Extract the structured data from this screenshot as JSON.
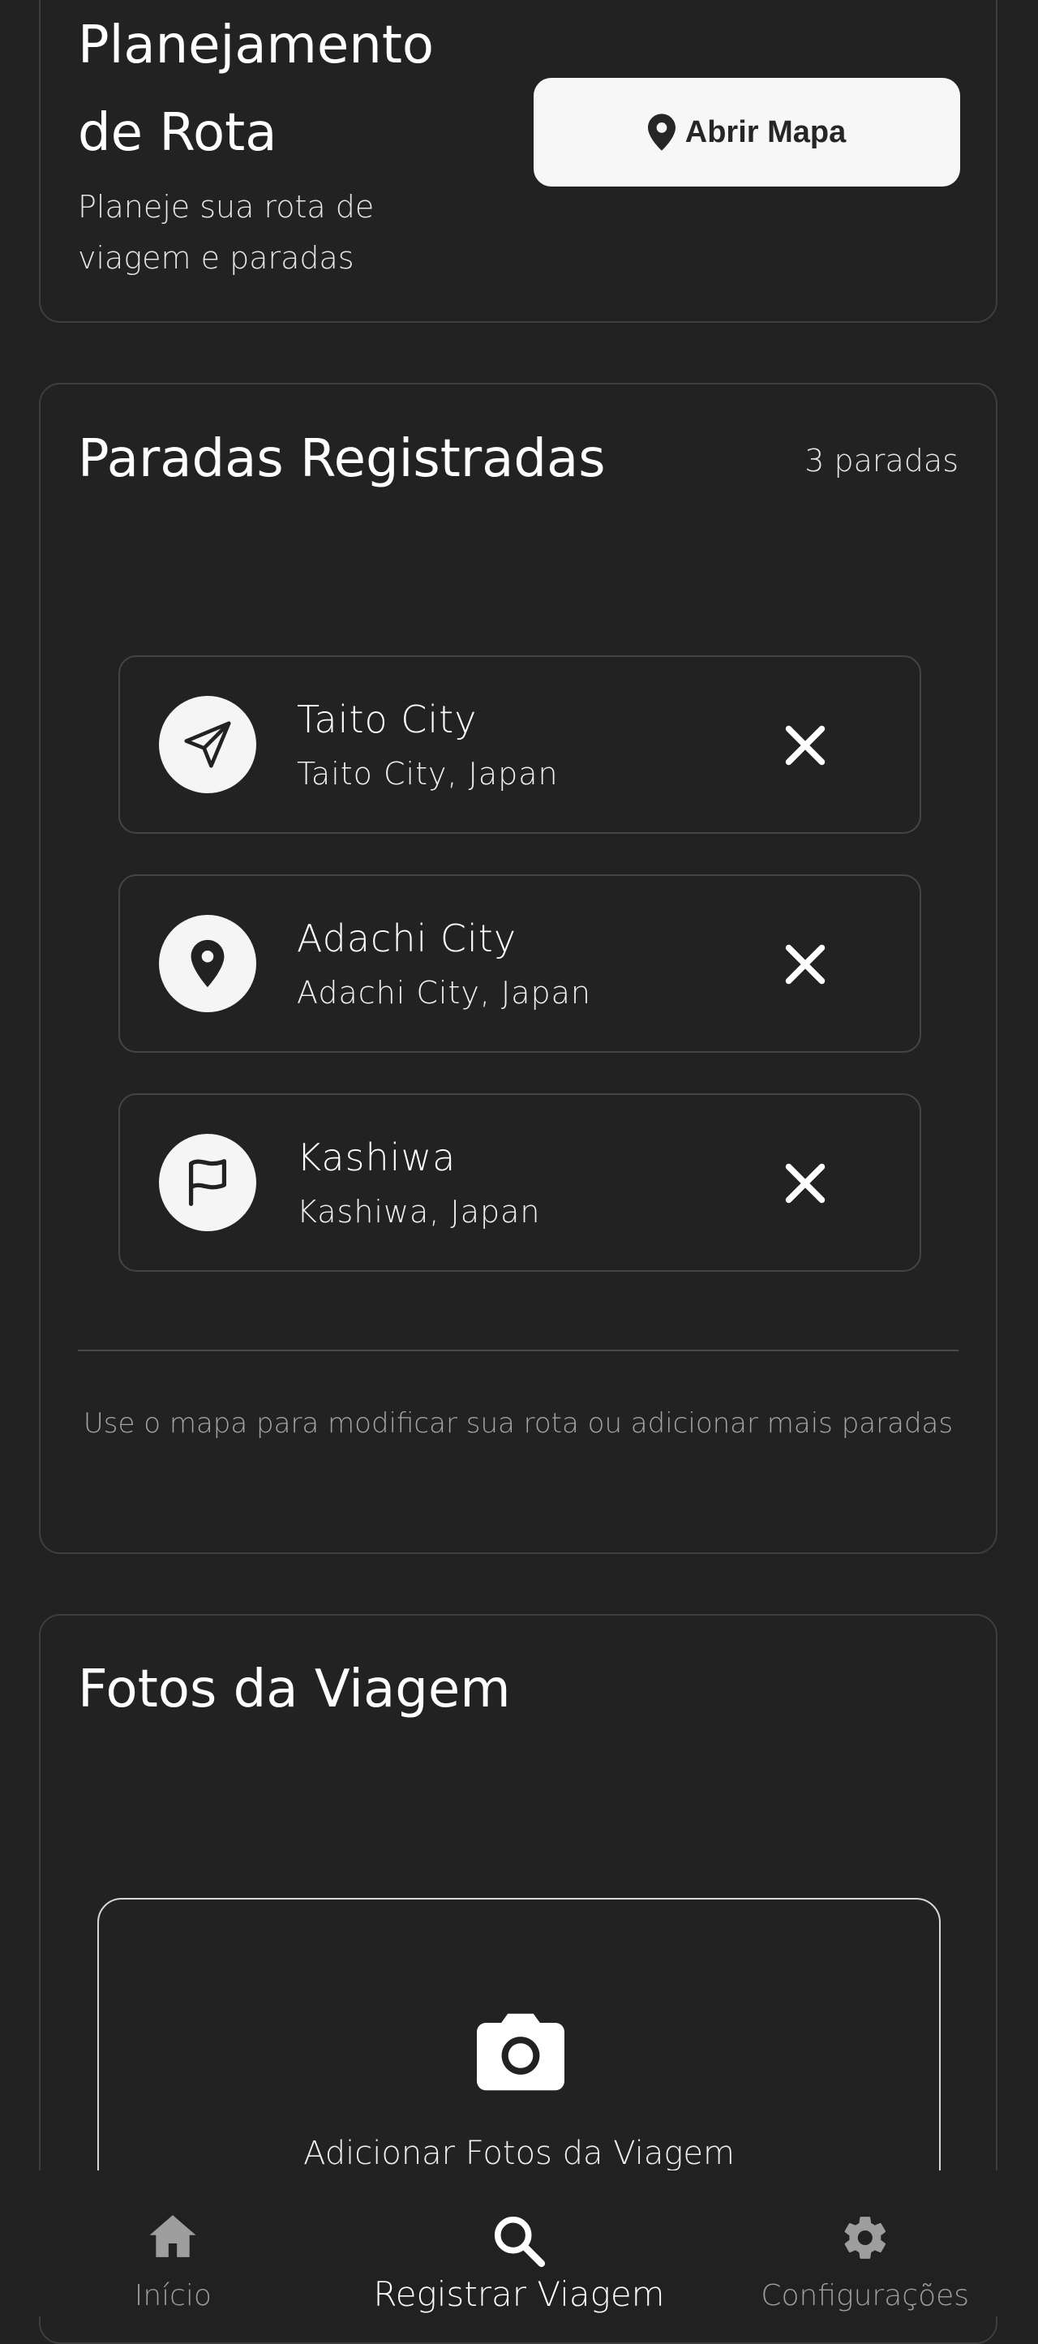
{
  "route_planning": {
    "title_line1": "Planejamento",
    "title_line2": "de Rota",
    "subtitle_line1": "Planeje sua rota de",
    "subtitle_line2": "viagem e paradas",
    "map_button_label": "Abrir Mapa",
    "map_button_icon": "map-pin-icon"
  },
  "stops": {
    "title": "Paradas Registradas",
    "count_label": "3 paradas",
    "items": [
      {
        "name": "Taito City",
        "location": "Taito City, Japan",
        "icon": "send-icon"
      },
      {
        "name": "Adachi City",
        "location": "Adachi City, Japan",
        "icon": "location-pin-icon"
      },
      {
        "name": "Kashiwa",
        "location": "Kashiwa, Japan",
        "icon": "flag-icon"
      }
    ],
    "hint": "Use o mapa para modificar sua rota ou adicionar mais paradas"
  },
  "photos": {
    "title": "Fotos da Viagem",
    "add_label": "Adicionar Fotos da Viagem",
    "icon": "camera-icon"
  },
  "nav": {
    "items": [
      {
        "label": "Início",
        "icon": "home-icon",
        "active": false
      },
      {
        "label": "Registrar Viagem",
        "icon": "search-icon",
        "active": true
      },
      {
        "label": "Configurações",
        "icon": "gear-icon",
        "active": false
      }
    ]
  },
  "colors": {
    "background": "#212121",
    "card_border": "#3e3e3e",
    "button_bg": "#f7f7f7",
    "muted_text": "#9e9e9e"
  }
}
